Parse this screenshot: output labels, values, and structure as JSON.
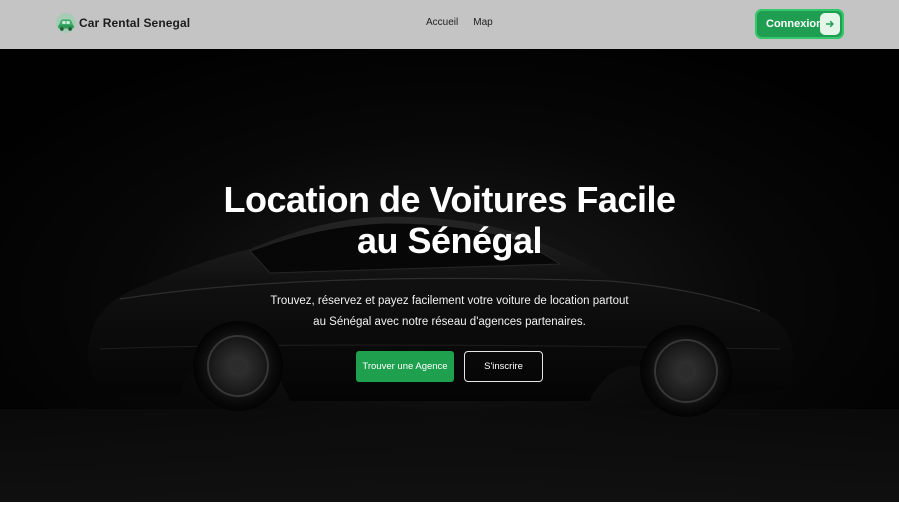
{
  "navbar": {
    "brand_name": "Car Rental Senegal",
    "brand_icon": "car-logo-icon",
    "links": [
      {
        "label": "Accueil"
      },
      {
        "label": "Map"
      }
    ],
    "login_label": "Connexion",
    "login_icon": "arrow-right-icon",
    "accent_color": "#1f9e52"
  },
  "hero": {
    "title_line1": "Location de Voitures Facile",
    "title_line2": "au Sénégal",
    "subtitle_line1": "Trouvez, réservez et payez facilement votre voiture de location partout",
    "subtitle_line2": "au Sénégal avec notre réseau d'agences partenaires.",
    "primary_button": "Trouver une Agence",
    "secondary_button": "S'inscrire",
    "background": "dark-car-photo"
  }
}
